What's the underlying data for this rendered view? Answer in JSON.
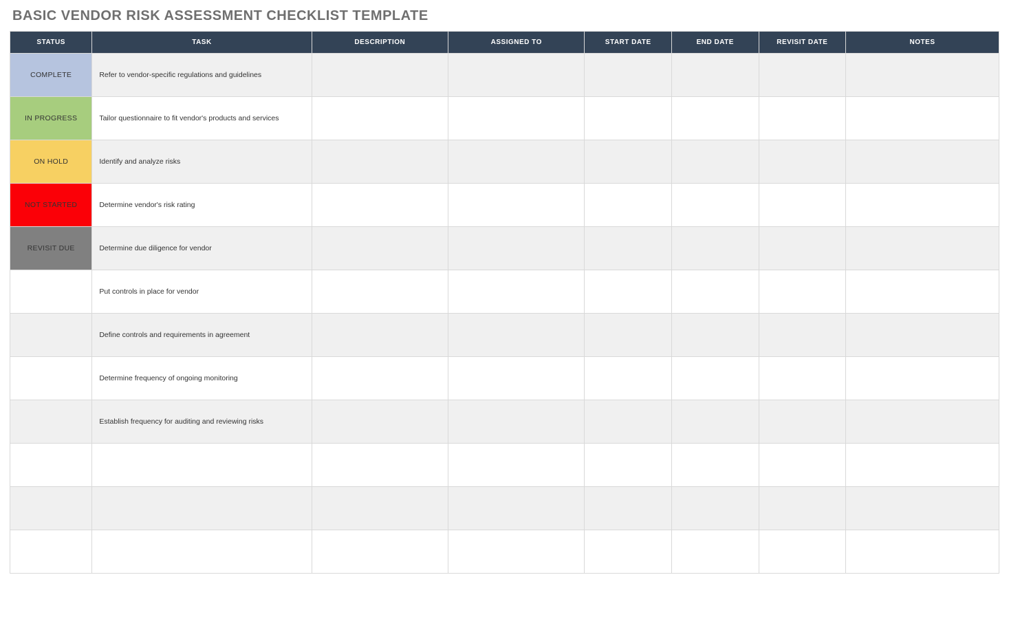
{
  "title": "BASIC VENDOR RISK ASSESSMENT CHECKLIST TEMPLATE",
  "columns": {
    "status": "STATUS",
    "task": "TASK",
    "desc": "DESCRIPTION",
    "assigned": "ASSIGNED TO",
    "start": "START DATE",
    "end": "END DATE",
    "revisit": "REVISIT DATE",
    "notes": "NOTES"
  },
  "status_colors": {
    "COMPLETE": "#b6c4df",
    "IN PROGRESS": "#a7cd7e",
    "ON HOLD": "#f7d062",
    "NOT STARTED": "#fb0007",
    "REVISIT DUE": "#808080"
  },
  "rows": [
    {
      "status": "COMPLETE",
      "task": "Refer to vendor-specific regulations and guidelines",
      "desc": "",
      "assigned": "",
      "start": "",
      "end": "",
      "revisit": "",
      "notes": ""
    },
    {
      "status": "IN PROGRESS",
      "task": "Tailor questionnaire to fit vendor's products and services",
      "desc": "",
      "assigned": "",
      "start": "",
      "end": "",
      "revisit": "",
      "notes": ""
    },
    {
      "status": "ON HOLD",
      "task": "Identify and analyze risks",
      "desc": "",
      "assigned": "",
      "start": "",
      "end": "",
      "revisit": "",
      "notes": ""
    },
    {
      "status": "NOT STARTED",
      "task": "Determine vendor's risk rating",
      "desc": "",
      "assigned": "",
      "start": "",
      "end": "",
      "revisit": "",
      "notes": ""
    },
    {
      "status": "REVISIT DUE",
      "task": "Determine due diligence for vendor",
      "desc": "",
      "assigned": "",
      "start": "",
      "end": "",
      "revisit": "",
      "notes": ""
    },
    {
      "status": "",
      "task": "Put controls in place for vendor",
      "desc": "",
      "assigned": "",
      "start": "",
      "end": "",
      "revisit": "",
      "notes": ""
    },
    {
      "status": "",
      "task": "Define controls and requirements in agreement",
      "desc": "",
      "assigned": "",
      "start": "",
      "end": "",
      "revisit": "",
      "notes": ""
    },
    {
      "status": "",
      "task": "Determine frequency of ongoing monitoring",
      "desc": "",
      "assigned": "",
      "start": "",
      "end": "",
      "revisit": "",
      "notes": ""
    },
    {
      "status": "",
      "task": "Establish frequency for auditing and reviewing risks",
      "desc": "",
      "assigned": "",
      "start": "",
      "end": "",
      "revisit": "",
      "notes": ""
    },
    {
      "status": "",
      "task": "",
      "desc": "",
      "assigned": "",
      "start": "",
      "end": "",
      "revisit": "",
      "notes": ""
    },
    {
      "status": "",
      "task": "",
      "desc": "",
      "assigned": "",
      "start": "",
      "end": "",
      "revisit": "",
      "notes": ""
    },
    {
      "status": "",
      "task": "",
      "desc": "",
      "assigned": "",
      "start": "",
      "end": "",
      "revisit": "",
      "notes": ""
    }
  ]
}
